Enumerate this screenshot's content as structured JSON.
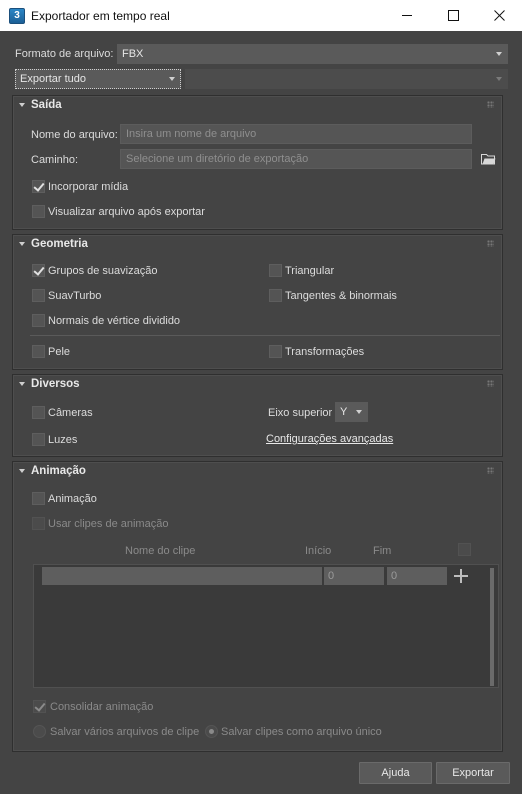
{
  "window": {
    "title": "Exportador em tempo real",
    "app_icon_label": "3"
  },
  "format": {
    "label": "Formato de arquivo:",
    "value": "FBX"
  },
  "export_scope": {
    "value": "Exportar tudo",
    "secondary_value": ""
  },
  "output": {
    "title": "Saída",
    "filename_label": "Nome do arquivo:",
    "filename_placeholder": "Insira um nome de arquivo",
    "path_label": "Caminho:",
    "path_placeholder": "Selecione um diretório de exportação",
    "embed_media_label": "Incorporar mídia",
    "embed_media_checked": true,
    "view_after_label": "Visualizar arquivo após exportar",
    "view_after_checked": false
  },
  "geometry": {
    "title": "Geometria",
    "smoothing_groups_label": "Grupos de suavização",
    "smoothing_groups_checked": true,
    "triangulate_label": "Triangular",
    "turbosmooth_label": "SuavTurbo",
    "tangents_label": "Tangentes & binormais",
    "split_normals_label": "Normais de vértice dividido",
    "skin_label": "Pele",
    "morphs_label": "Transformações"
  },
  "misc": {
    "title": "Diversos",
    "cameras_label": "Câmeras",
    "lights_label": "Luzes",
    "up_axis_label": "Eixo superior",
    "up_axis_value": "Y",
    "advanced_link": "Configurações avançadas"
  },
  "animation": {
    "title": "Animação",
    "animation_label": "Animação",
    "use_clips_label": "Usar clipes de animação",
    "col_clip_name": "Nome do clipe",
    "col_start": "Início",
    "col_end": "Fim",
    "clip_start_value": "0",
    "clip_end_value": "0",
    "bake_label": "Consolidar animação",
    "bake_checked": true,
    "save_multiple_label": "Salvar vários arquivos de clipe",
    "save_single_label": "Salvar clipes como arquivo único"
  },
  "footer": {
    "help_label": "Ajuda",
    "export_label": "Exportar"
  }
}
